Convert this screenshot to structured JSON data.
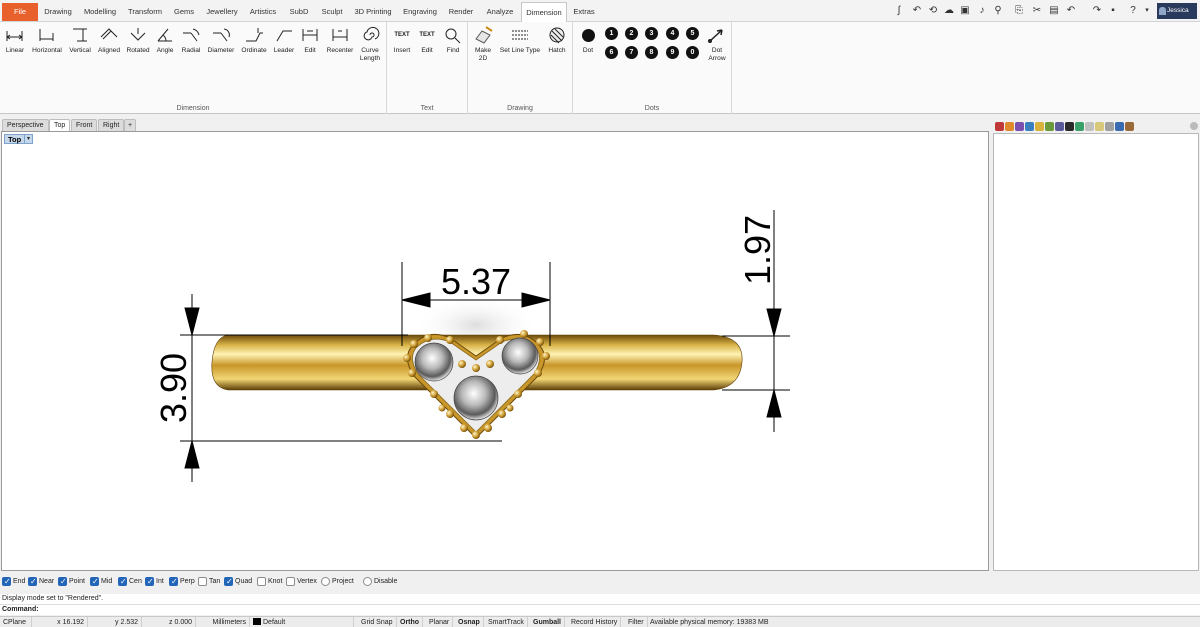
{
  "menu": {
    "file": "File",
    "tabs": [
      "Drawing",
      "Modelling",
      "Transform",
      "Gems",
      "Jewellery",
      "Artistics",
      "SubD",
      "Sculpt",
      "3D Printing",
      "Engraving",
      "Render",
      "Analyze",
      "Dimension",
      "Extras"
    ],
    "active_tab": "Dimension",
    "user": "Jessica"
  },
  "ribbon": {
    "dimension": {
      "label": "Dimension",
      "tools": [
        "Linear",
        "Horizontal",
        "Vertical",
        "Aligned",
        "Rotated",
        "Angle",
        "Radial",
        "Diameter",
        "Ordinate",
        "Leader",
        "Edit",
        "Recenter"
      ],
      "curve_length": [
        "Curve",
        "Length"
      ]
    },
    "text": {
      "label": "Text",
      "tools": [
        "Insert",
        "Edit",
        "Find"
      ],
      "icon_text": "TEXT"
    },
    "drawing": {
      "label": "Drawing",
      "make2d": [
        "Make",
        "2D"
      ],
      "tools": [
        "Set Line Type",
        "Hatch"
      ]
    },
    "dots": {
      "label": "Dots",
      "dot": "Dot",
      "numbers_row1": [
        "1",
        "2",
        "3",
        "4",
        "5"
      ],
      "numbers_row2": [
        "6",
        "7",
        "8",
        "9",
        "0"
      ],
      "dot_arrow": [
        "Dot",
        "Arrow"
      ]
    }
  },
  "viewport_tabs": [
    "Perspective",
    "Top",
    "Front",
    "Right"
  ],
  "active_viewport_tab": "Top",
  "viewport": {
    "label": "Top",
    "dimensions": {
      "width_top": "5.37",
      "height_left": "3.90",
      "height_right": "1.97"
    }
  },
  "osnaps": [
    {
      "label": "End",
      "checked": true
    },
    {
      "label": "Near",
      "checked": true
    },
    {
      "label": "Point",
      "checked": true
    },
    {
      "label": "Mid",
      "checked": true
    },
    {
      "label": "Cen",
      "checked": true
    },
    {
      "label": "Int",
      "checked": true
    },
    {
      "label": "Perp",
      "checked": true
    },
    {
      "label": "Tan",
      "checked": false
    },
    {
      "label": "Quad",
      "checked": true
    },
    {
      "label": "Knot",
      "checked": false
    },
    {
      "label": "Vertex",
      "checked": false
    },
    {
      "label": "Project",
      "checked": false
    },
    {
      "label": "Disable",
      "checked": false
    }
  ],
  "command": {
    "history": "Display mode set to \"Rendered\".",
    "prompt": "Command:"
  },
  "status": {
    "cplane": "CPlane",
    "x": "x 16.192",
    "y": "y 2.532",
    "z": "z 0.000",
    "units": "Millimeters",
    "layer": "Default",
    "grid_snap": "Grid Snap",
    "ortho": "Ortho",
    "planar": "Planar",
    "osnap": "Osnap",
    "smarttrack": "SmartTrack",
    "gumball": "Gumball",
    "record_history": "Record History",
    "filter": "Filter",
    "memory": "Available physical memory: 19383 MB"
  },
  "colors": {
    "file_tab": "#e8602c",
    "accent": "#2366b8",
    "gold": "#d4aa2a"
  }
}
